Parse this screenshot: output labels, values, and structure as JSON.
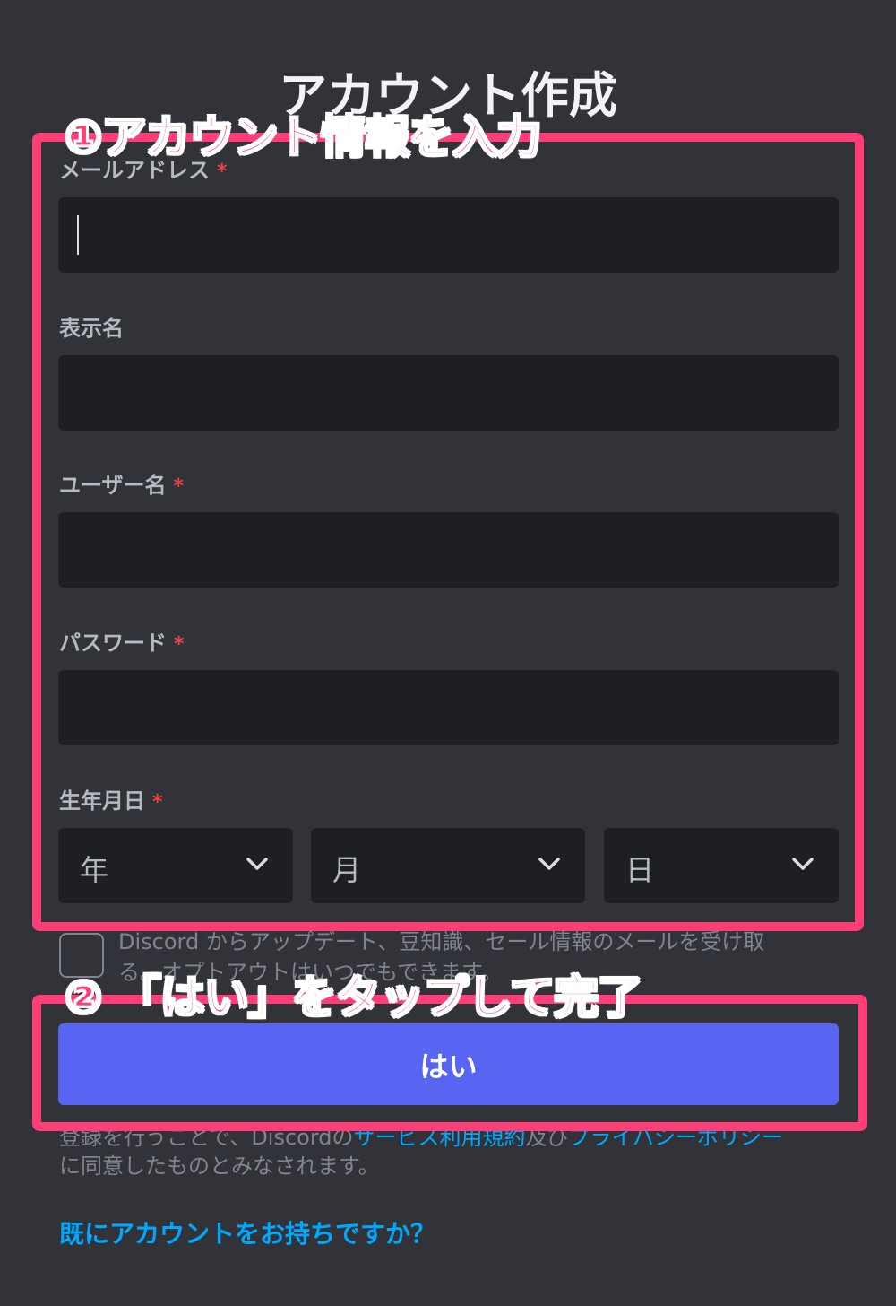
{
  "page": {
    "title": "アカウント作成"
  },
  "annotations": {
    "step1": "①アカウント情報を入力",
    "step2": "② 「はい」をタップして完了",
    "color": "#ff3d77"
  },
  "form": {
    "email": {
      "label": "メールアドレス",
      "required": "*",
      "value": ""
    },
    "display_name": {
      "label": "表示名",
      "value": ""
    },
    "username": {
      "label": "ユーザー名",
      "required": "*",
      "value": ""
    },
    "password": {
      "label": "パスワード",
      "required": "*",
      "value": ""
    },
    "birthday": {
      "label": "生年月日",
      "required": "*",
      "year": "年",
      "month": "月",
      "day": "日"
    },
    "optin": "Discord からアップデート、豆知識、セール情報のメールを受け取る。オプトアウトはいつでもできます。",
    "submit": "はい"
  },
  "terms": {
    "prefix": "登録を行うことで、Discordの",
    "tos": "サービス利用規約",
    "middle": "及び",
    "privacy": "プライバシーポリシー",
    "suffix": "に同意したものとみなされます。"
  },
  "login_link": "既にアカウントをお持ちですか？",
  "colors": {
    "background": "#313338",
    "input": "#1e1f22",
    "primary": "#5865f2",
    "link": "#00a8fc",
    "required": "#f23f42"
  }
}
